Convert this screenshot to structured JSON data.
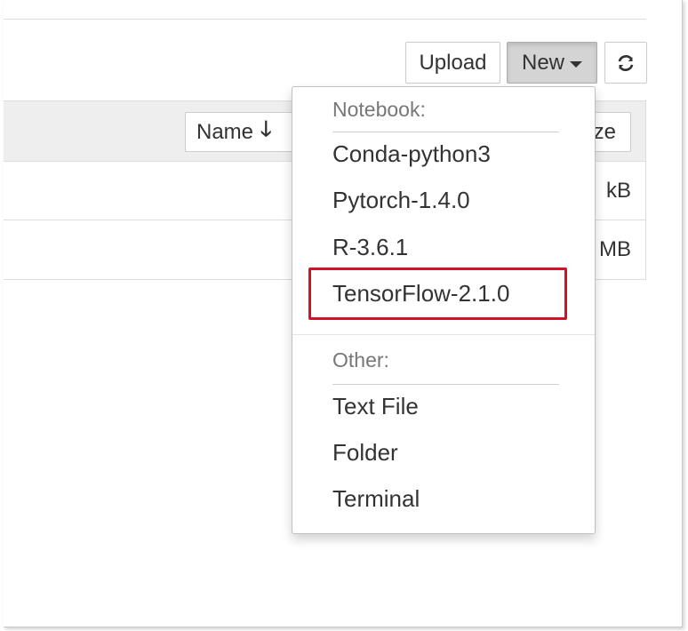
{
  "toolbar": {
    "upload_label": "Upload",
    "new_label": "New",
    "refresh_icon": "refresh-icon"
  },
  "file_list": {
    "sort_name_label": "Name",
    "sort_name_icon": "arrow-down-icon",
    "sort_name_arrow": "🡓",
    "sort_size_label_visible": "ze",
    "rows": [
      {
        "size": "kB"
      },
      {
        "size": "MB"
      }
    ]
  },
  "new_menu": {
    "notebook_header": "Notebook:",
    "notebook_items": [
      "Conda-python3",
      "Pytorch-1.4.0",
      "R-3.6.1",
      "TensorFlow-2.1.0"
    ],
    "other_header": "Other:",
    "other_items": [
      "Text File",
      "Folder",
      "Terminal"
    ]
  },
  "annotation": {
    "highlighted_item": "TensorFlow-2.1.0",
    "highlight_color": "#d11227"
  },
  "colors": {
    "active_button_bg": "#d4d4d4",
    "header_bg": "#eeeeee",
    "text": "#333333",
    "muted_text": "#777777"
  }
}
